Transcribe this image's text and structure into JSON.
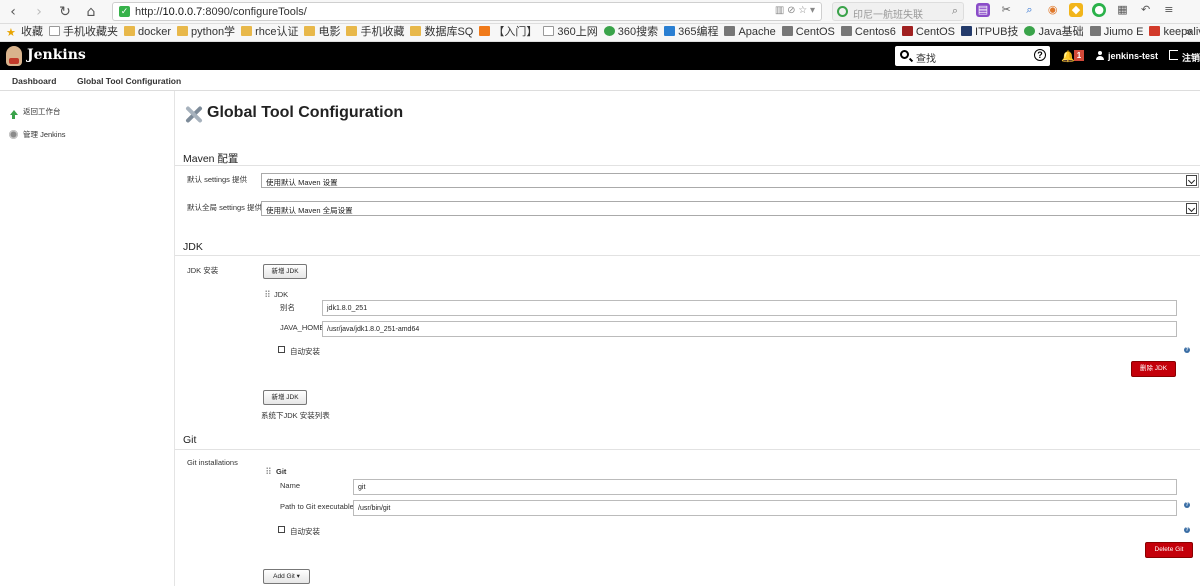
{
  "browser": {
    "url_prefix": "http://",
    "url_host": "10.0.0.7",
    "url_path": ":8090/configureTools/",
    "search_placeholder": "印尼一航班失联",
    "bookmarks": [
      {
        "label": "收藏",
        "icon": "star"
      },
      {
        "label": "手机收藏夹",
        "icon": "page"
      },
      {
        "label": "docker",
        "icon": "folder"
      },
      {
        "label": "python学",
        "icon": "folder"
      },
      {
        "label": "rhce认证",
        "icon": "folder"
      },
      {
        "label": "电影",
        "icon": "folder"
      },
      {
        "label": "手机收藏",
        "icon": "folder"
      },
      {
        "label": "数据库SQ",
        "icon": "folder"
      },
      {
        "label": "【入门】",
        "icon": "orange"
      },
      {
        "label": "360上网",
        "icon": "page"
      },
      {
        "label": "360搜索",
        "icon": "green"
      },
      {
        "label": "365编程",
        "icon": "blue"
      },
      {
        "label": "Apache",
        "icon": "grey"
      },
      {
        "label": "CentOS",
        "icon": "grey"
      },
      {
        "label": "Centos6",
        "icon": "grey"
      },
      {
        "label": "CentOS",
        "icon": "darkred"
      },
      {
        "label": "ITPUB技",
        "icon": "navy"
      },
      {
        "label": "Java基础",
        "icon": "green"
      },
      {
        "label": "Jiumo E",
        "icon": "grey"
      },
      {
        "label": "keepaliv",
        "icon": "red"
      }
    ],
    "more_label": "»"
  },
  "header": {
    "title": "Jenkins",
    "search_placeholder": "查找",
    "help_label": "?",
    "notification_count": "1",
    "username": "jenkins-test",
    "logout_label": "注销"
  },
  "breadcrumb": [
    "Dashboard",
    "Global Tool Configuration"
  ],
  "sidebar": {
    "items": [
      {
        "label": "返回工作台",
        "icon": "arrow-up-icon"
      },
      {
        "label": "管理 Jenkins",
        "icon": "gear-icon"
      }
    ]
  },
  "page": {
    "title": "Global Tool Configuration"
  },
  "maven": {
    "section_title": "Maven 配置",
    "settings_label": "默认 settings 提供",
    "settings_value": "使用默认 Maven 设置",
    "global_settings_label": "默认全局 settings 提供",
    "global_settings_value": "使用默认 Maven 全局设置"
  },
  "jdk": {
    "section_title": "JDK",
    "install_label": "JDK 安装",
    "add_button": "新增 JDK",
    "item_title": "JDK",
    "alias_label": "别名",
    "alias_value": "jdk1.8.0_251",
    "home_label": "JAVA_HOME",
    "home_value": "/usr/java/jdk1.8.0_251-amd64",
    "auto_install_label": "自动安装",
    "delete_button": "删除 JDK",
    "add_button_bottom": "新增 JDK",
    "list_hint": "系统下JDK 安装列表"
  },
  "git": {
    "section_title": "Git",
    "install_label": "Git installations",
    "item_title": "Git",
    "name_label": "Name",
    "name_value": "git",
    "path_label": "Path to Git executable",
    "path_value": "/usr/bin/git",
    "auto_install_label": "自动安装",
    "delete_button": "Delete Git",
    "add_button": "Add Git ▾"
  },
  "colors": {
    "header_bg": "#000000",
    "danger": "#c4000a",
    "help": "#3a6ea5"
  }
}
